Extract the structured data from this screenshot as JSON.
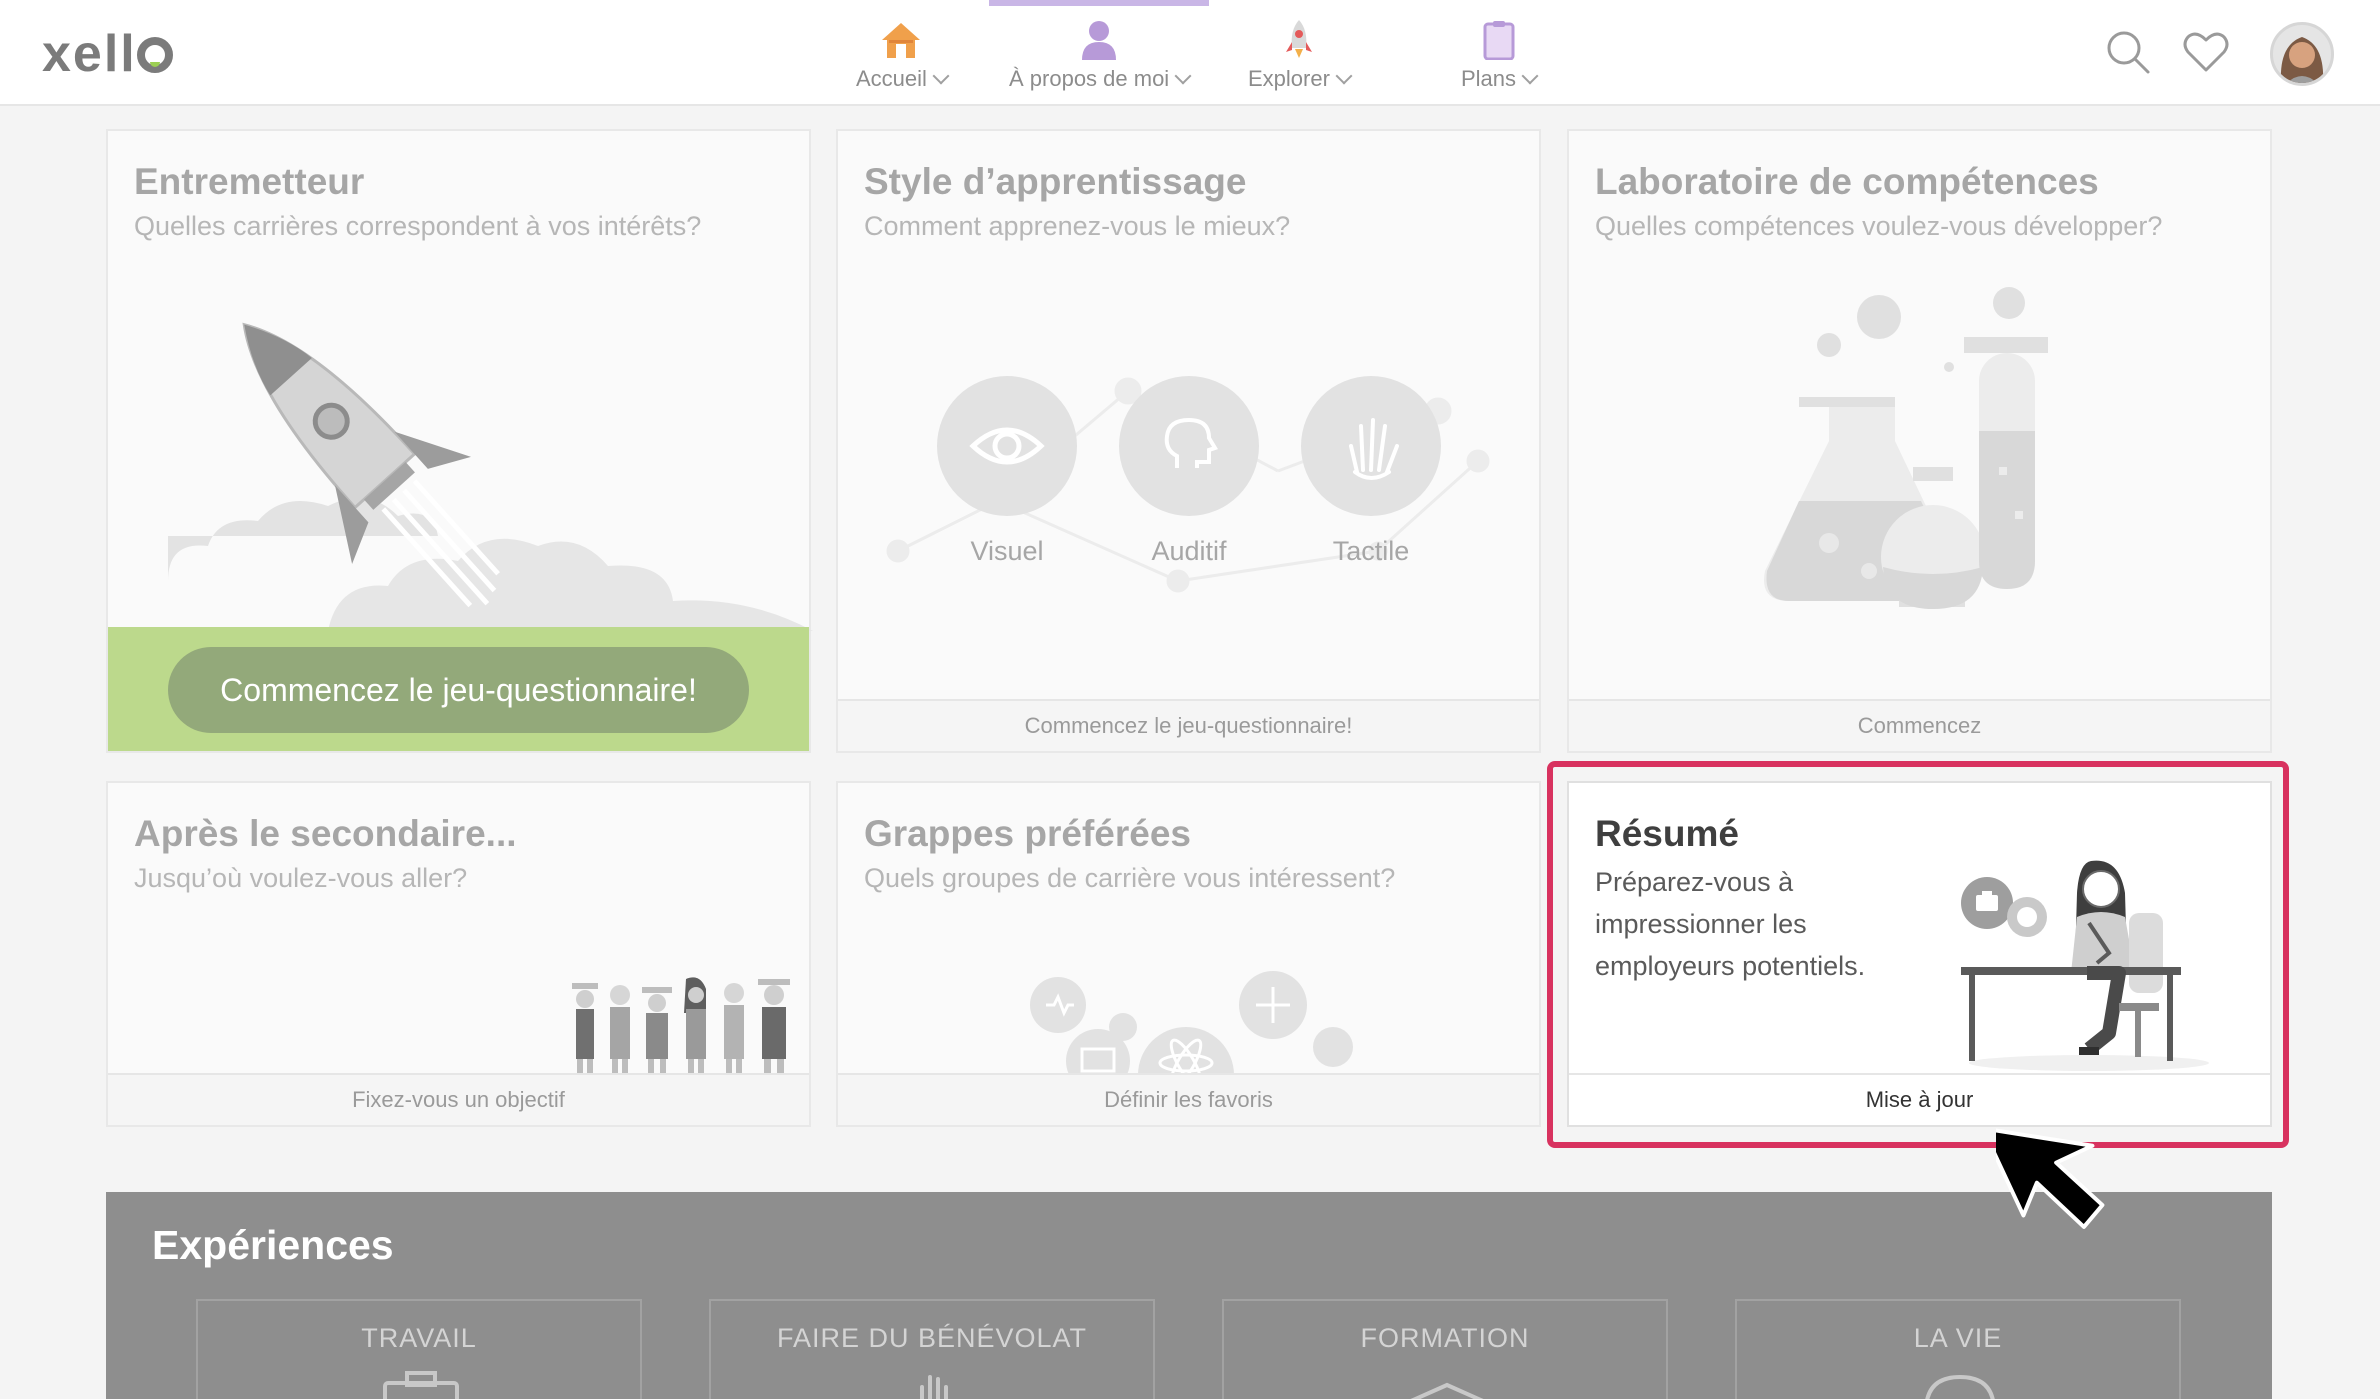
{
  "app": {
    "logo": "xello"
  },
  "nav": {
    "items": [
      {
        "label": "Accueil",
        "icon": "house-icon"
      },
      {
        "label": "À propos de moi",
        "icon": "person-icon",
        "active": true
      },
      {
        "label": "Explorer",
        "icon": "rocket-icon"
      },
      {
        "label": "Plans",
        "icon": "clipboard-icon"
      }
    ],
    "tools": [
      "search-icon",
      "heart-icon",
      "avatar"
    ]
  },
  "cards": [
    {
      "title": "Entremetteur",
      "subtitle": "Quelles carrières correspondent à vos intérêts?",
      "action": "Commencez le jeu-questionnaire!"
    },
    {
      "title": "Style d’apprentissage",
      "subtitle": "Comment apprenez-vous le mieux?",
      "styles": [
        "Visuel",
        "Auditif",
        "Tactile"
      ],
      "footer": "Commencez le jeu-questionnaire!"
    },
    {
      "title": "Laboratoire de compétences",
      "subtitle": "Quelles compétences voulez-vous développer?",
      "footer": "Commencez"
    },
    {
      "title": "Après le secondaire...",
      "subtitle": "Jusqu’où voulez-vous aller?",
      "footer": "Fixez-vous un objectif"
    },
    {
      "title": "Grappes préférées",
      "subtitle": "Quels groupes de carrière vous intéressent?",
      "footer": "Définir les favoris"
    }
  ],
  "resume": {
    "title": "Résumé",
    "description": "Préparez-vous à impressionner les employeurs potentiels.",
    "footer": "Mise à jour"
  },
  "experiences": {
    "title": "Expériences",
    "tiles": [
      "TRAVAIL",
      "FAIRE DU BÉNÉVOLAT",
      "FORMATION",
      "LA VIE"
    ]
  },
  "colors": {
    "highlight": "#d8325f",
    "green_band": "#bcd98c",
    "green_button": "#93a97a",
    "nav_active": "#c9b6e6"
  }
}
